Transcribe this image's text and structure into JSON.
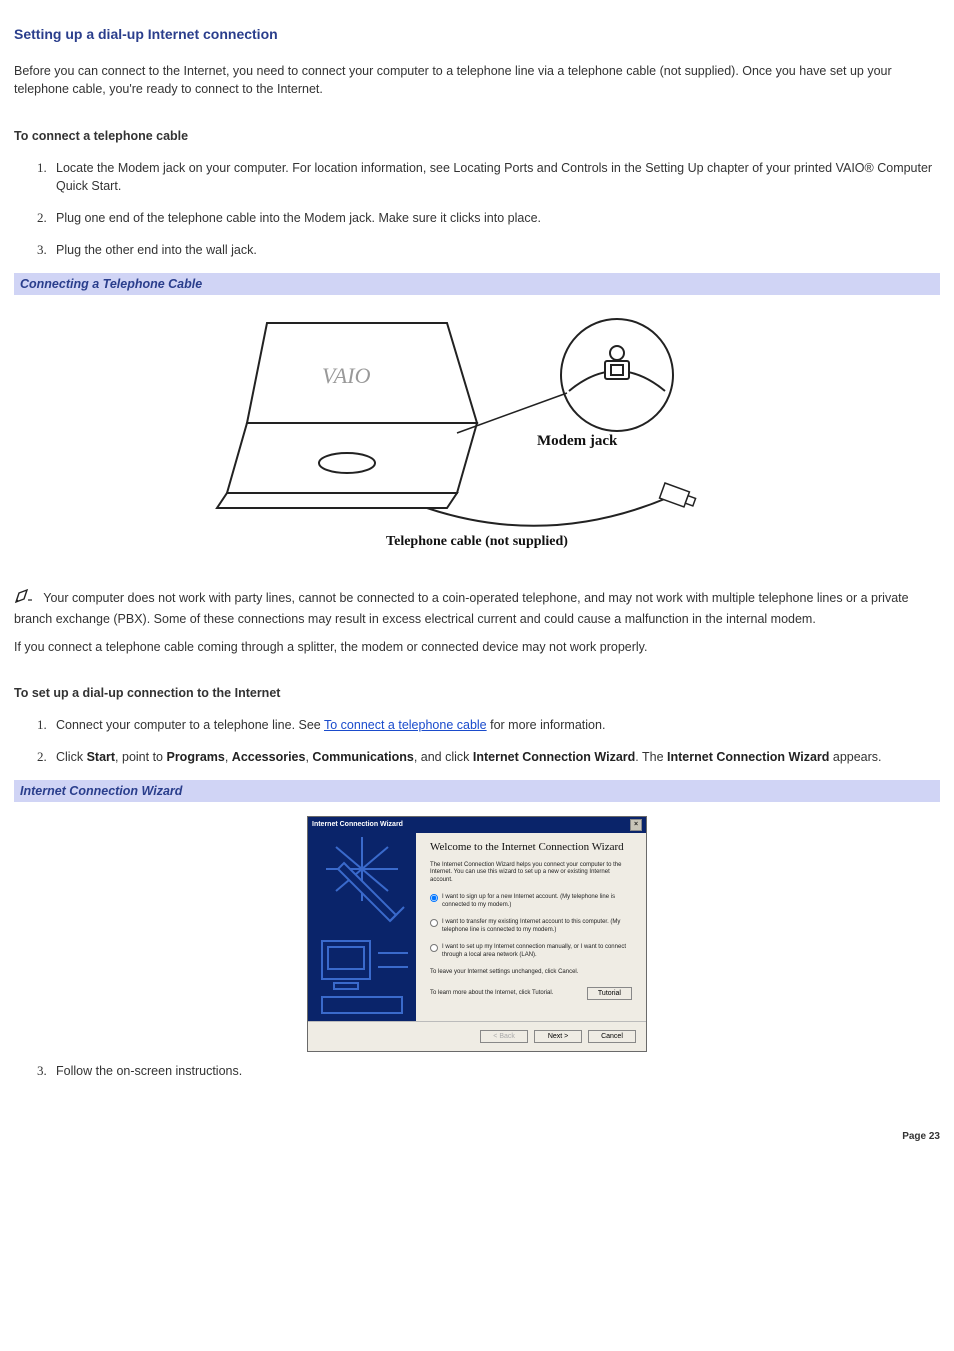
{
  "title": "Setting up a dial-up Internet connection",
  "intro": "Before you can connect to the Internet, you need to connect your computer to a telephone line via a telephone cable (not supplied). Once you have set up your telephone cable, you're ready to connect to the Internet.",
  "section1": {
    "heading": "To connect a telephone cable",
    "steps": [
      "Locate the Modem jack on your computer. For location information, see Locating Ports and Controls in the Setting Up chapter of your printed VAIO® Computer Quick Start.",
      "Plug one end of the telephone cable into the Modem jack. Make sure it clicks into place.",
      "Plug the other end into the wall jack."
    ]
  },
  "caption1": "Connecting a Telephone Cable",
  "figure1": {
    "label_modem": "Modem jack",
    "label_cable": "Telephone cable (not supplied)"
  },
  "note1": "Your computer does not work with party lines, cannot be connected to a coin-operated telephone, and may not work with multiple telephone lines or a private branch exchange (PBX). Some of these connections may result in excess electrical current and could cause a malfunction in the internal modem.",
  "note2": "If you connect a telephone cable coming through a splitter, the modem or connected device may not work properly.",
  "section2": {
    "heading": "To set up a dial-up connection to the Internet",
    "step1_a": "Connect your computer to a telephone line. See ",
    "step1_link": "To connect a telephone cable",
    "step1_b": " for more information.",
    "step2_a": "Click ",
    "step2_start": "Start",
    "step2_b": ", point to ",
    "step2_programs": "Programs",
    "step2_c": ", ",
    "step2_accessories": "Accessories",
    "step2_d": ", ",
    "step2_comm": "Communications",
    "step2_e": ", and click ",
    "step2_icw": "Internet Connection Wizard",
    "step2_f": ". The ",
    "step2_icw2": "Internet Connection Wizard",
    "step2_g": " appears.",
    "step3": "Follow the on-screen instructions."
  },
  "caption2": "Internet Connection Wizard",
  "wizard": {
    "titlebar": "Internet Connection Wizard",
    "heading": "Welcome to the Internet Connection Wizard",
    "desc": "The Internet Connection Wizard helps you connect your computer to the Internet. You can use this wizard to set up a new or existing Internet account.",
    "opt1": "I want to sign up for a new Internet account. (My telephone line is connected to my modem.)",
    "opt2": "I want to transfer my existing Internet account to this computer. (My telephone line is connected to my modem.)",
    "opt3": "I want to set up my Internet connection manually, or I want to connect through a local area network (LAN).",
    "leave": "To leave your Internet settings unchanged, click Cancel.",
    "tutorial": "To learn more about the Internet, click Tutorial.",
    "btn_tutorial": "Tutorial",
    "btn_back": "< Back",
    "btn_next": "Next >",
    "btn_cancel": "Cancel"
  },
  "page": "Page 23"
}
